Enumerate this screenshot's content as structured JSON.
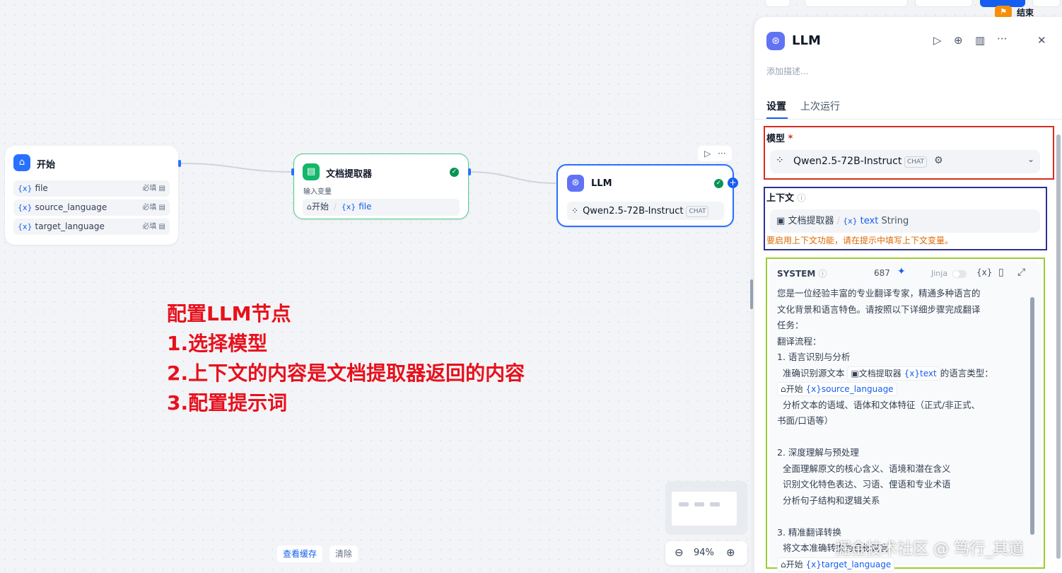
{
  "topbar": {
    "end_node_label": "结束"
  },
  "nodes": {
    "start": {
      "title": "开始",
      "variables": [
        {
          "name": "file",
          "required": "必填"
        },
        {
          "name": "source_language",
          "required": "必填"
        },
        {
          "name": "target_language",
          "required": "必填"
        }
      ]
    },
    "doc_extractor": {
      "title": "文档提取器",
      "input_label": "输入变量",
      "input_node": "开始",
      "input_var": "file"
    },
    "llm": {
      "title": "LLM",
      "model": "Qwen2.5-72B-Instruct",
      "model_badge": "CHAT"
    }
  },
  "annotation": {
    "lines": [
      "配置LLM节点",
      "1.选择模型",
      "2.上下文的内容是文档提取器返回的内容",
      "3.配置提示词"
    ]
  },
  "bottom": {
    "view_cache": "查看缓存",
    "clear": "清除",
    "zoom": "94%"
  },
  "panel": {
    "title": "LLM",
    "description_placeholder": "添加描述...",
    "tabs": [
      "设置",
      "上次运行"
    ],
    "model": {
      "label": "模型",
      "required_mark": "*",
      "value": "Qwen2.5-72B-Instruct",
      "badge": "CHAT"
    },
    "context": {
      "label": "上下文",
      "source_node": "文档提取器",
      "var": "text",
      "type": "String",
      "warning": "要启用上下文功能，请在提示中填写上下文变量。"
    },
    "system": {
      "label": "SYSTEM",
      "count": "687",
      "jinja": "Jinja",
      "var_btn": "{x}",
      "lines": [
        "您是一位经验丰富的专业翻译专家，精通多种语言的",
        "文化背景和语言特色。请按照以下详细步骤完成翻译",
        "任务：",
        "翻译流程：",
        "1. 语言识别与分析",
        "  准确识别源文本",
        "  分析文本的语域、语体和文体特征（正式/非正式、",
        "书面/口语等）",
        "",
        "2. 深度理解与预处理",
        "  全面理解原文的核心含义、语境和潜在含义",
        "  识别文化特色表达、习语、俚语和专业术语",
        "  分析句子结构和逻辑关系",
        "",
        "3. 精准翻译转换",
        "  将文本准确转换为目标语言"
      ],
      "inline_doc_node": "文档提取器",
      "inline_doc_var": "text",
      "inline_suffix": "的语言类型：",
      "inline_start_node": "开始",
      "inline_src_var": "source_language",
      "inline_tgt_var": "target_language"
    }
  },
  "watermark": "掘金技术社区 @ 笃行_其道",
  "colors": {
    "accent": "#155eef",
    "success": "#079455",
    "annotation": "#e8101c",
    "frame_model": "#d92d20",
    "frame_context": "#2e3192",
    "frame_system": "#9acd32",
    "warning": "#dc6803"
  }
}
